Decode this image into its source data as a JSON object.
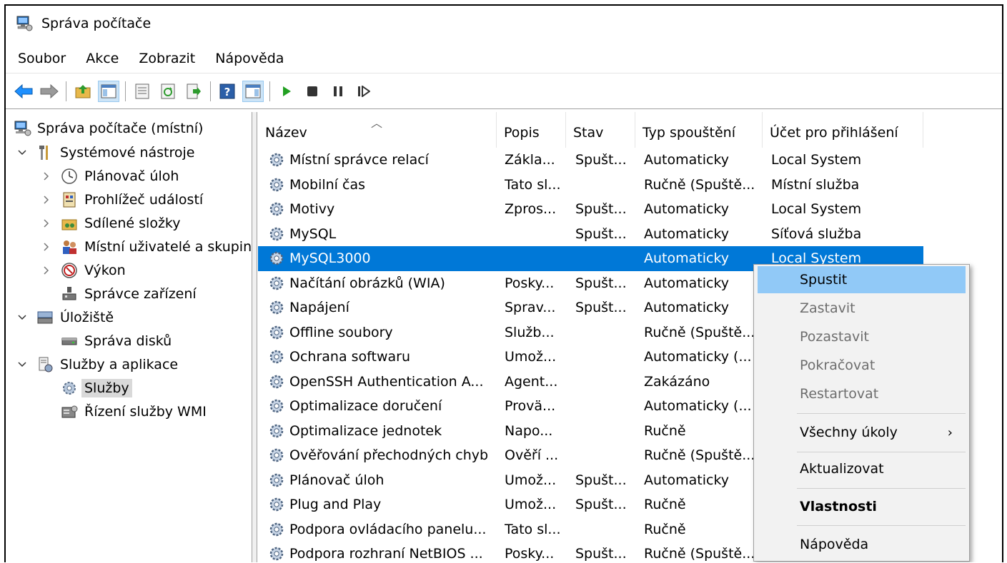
{
  "window": {
    "title": "Správa počítače"
  },
  "menu": [
    "Soubor",
    "Akce",
    "Zobrazit",
    "Nápověda"
  ],
  "toolbar": {
    "buttons": [
      "back-icon",
      "forward-icon",
      "up-folder-icon",
      "show-hide-tree-icon",
      "properties-icon",
      "refresh-icon",
      "export-list-icon",
      "help-icon",
      "show-hide-action-pane-icon",
      "start-service-icon",
      "stop-service-icon",
      "pause-service-icon",
      "resume-service-icon"
    ]
  },
  "tree": {
    "root": "Správa počítače (místní)",
    "system_tools": "Systémové nástroje",
    "task_scheduler": "Plánovač úloh",
    "event_viewer": "Prohlížeč událostí",
    "shared_folders": "Sdílené složky",
    "local_users": "Místní uživatelé a skupin",
    "performance": "Výkon",
    "device_manager": "Správce zařízení",
    "storage": "Úložiště",
    "disk_management": "Správa disků",
    "services_apps": "Služby a aplikace",
    "services": "Služby",
    "wmi_control": "Řízení služby WMI"
  },
  "columns": {
    "name": "Název",
    "description": "Popis",
    "status": "Stav",
    "startup": "Typ spouštění",
    "logon": "Účet pro přihlášení"
  },
  "services": [
    [
      "Místní správce relací",
      "Zákla...",
      "Spušt...",
      "Automaticky",
      "Local System"
    ],
    [
      "Mobilní čas",
      "Tato sl...",
      "",
      "Ručně (Spuště...",
      "Místní služba"
    ],
    [
      "Motivy",
      "Zpros...",
      "Spušt...",
      "Automaticky",
      "Local System"
    ],
    [
      "MySQL",
      "",
      "Spušt...",
      "Automaticky",
      "Síťová služba"
    ],
    [
      "MySQL3000",
      "",
      "",
      "Automaticky",
      "Local System"
    ],
    [
      "Načítání obrázků (WIA)",
      "Posky...",
      "Spušt...",
      "Automaticky",
      ""
    ],
    [
      "Napájení",
      "Sprav...",
      "Spušt...",
      "Automaticky",
      ""
    ],
    [
      "Offline soubory",
      "Služb...",
      "",
      "Ručně (Spuště...",
      ""
    ],
    [
      "Ochrana softwaru",
      "Umož...",
      "",
      "Automaticky (...",
      ""
    ],
    [
      "OpenSSH Authentication A...",
      "Agent...",
      "",
      "Zakázáno",
      ""
    ],
    [
      "Optimalizace doručení",
      "Provä...",
      "",
      "Automaticky (...",
      ""
    ],
    [
      "Optimalizace jednotek",
      "Napo...",
      "",
      "Ručně",
      ""
    ],
    [
      "Ověřování přechodných chyb",
      "Ověří ...",
      "",
      "Ručně (Spuště...",
      ""
    ],
    [
      "Plánovač úloh",
      "Umož...",
      "Spušt...",
      "Automaticky",
      ""
    ],
    [
      "Plug and Play",
      "Umož...",
      "Spušt...",
      "Ručně",
      ""
    ],
    [
      "Podpora ovládacího panelu...",
      "Tato sl...",
      "",
      "Ručně",
      ""
    ],
    [
      "Podpora rozhraní NetBIOS ...",
      "Posky...",
      "Spušt...",
      "Ručně (Spuště...",
      ""
    ]
  ],
  "selected_service": "MySQL3000",
  "context_menu": {
    "start": "Spustit",
    "stop": "Zastavit",
    "pause": "Pozastavit",
    "resume": "Pokračovat",
    "restart": "Restartovat",
    "all_tasks": "Všechny úkoly",
    "refresh": "Aktualizovat",
    "properties": "Vlastnosti",
    "help": "Nápověda",
    "submenu_arrow": "›"
  },
  "colors": {
    "selection": "#0078d7",
    "menu_hot": "#91c9f7",
    "menu_bg": "#f2f2f2"
  }
}
